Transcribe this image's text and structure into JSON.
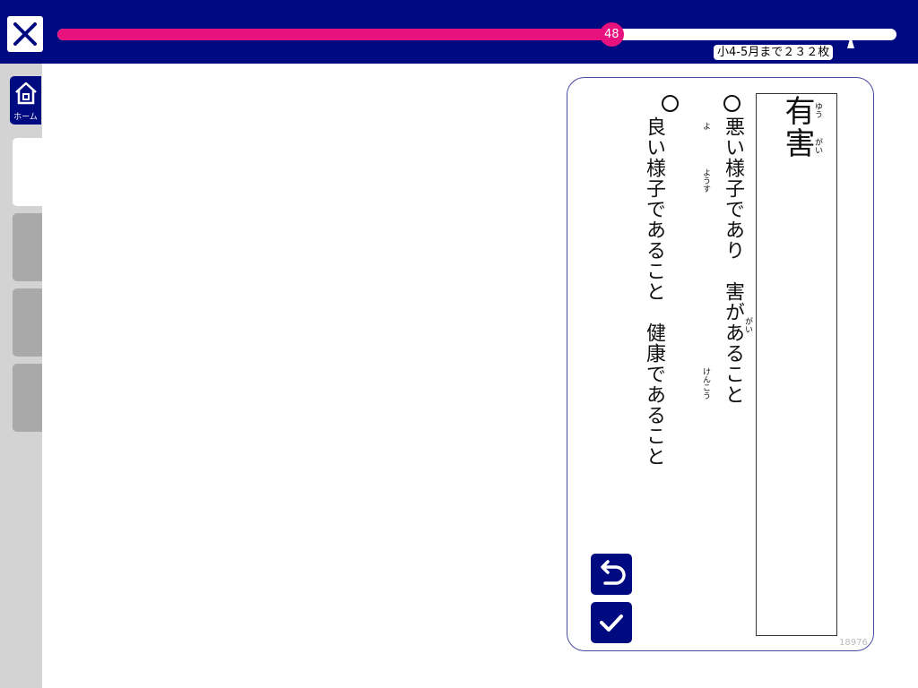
{
  "topbar": {
    "progress": {
      "value": 48,
      "label": "48",
      "fraction": 0.66
    },
    "goal_label": "小4-5月まで２３２枚"
  },
  "sidebar": {
    "home_label": "ホーム"
  },
  "card": {
    "term": "有害",
    "term_readings": [
      "ゆう",
      "がい"
    ],
    "choices": [
      {
        "text": "悪い様子であり　害があること",
        "readings": [
          "がい"
        ]
      },
      {
        "text": "良い様子であること　健康であること",
        "readings": [
          "よ",
          "ようす",
          "けんこう"
        ]
      }
    ],
    "card_id": "18976"
  },
  "colors": {
    "navy": "#000a80",
    "pink": "#e8127e",
    "sidebar": "#d3d3d3",
    "tab_inactive": "#a9a9a9",
    "card_border": "#4a4aa0"
  },
  "icons": [
    "close-icon",
    "home-icon",
    "undo-icon",
    "check-icon"
  ]
}
